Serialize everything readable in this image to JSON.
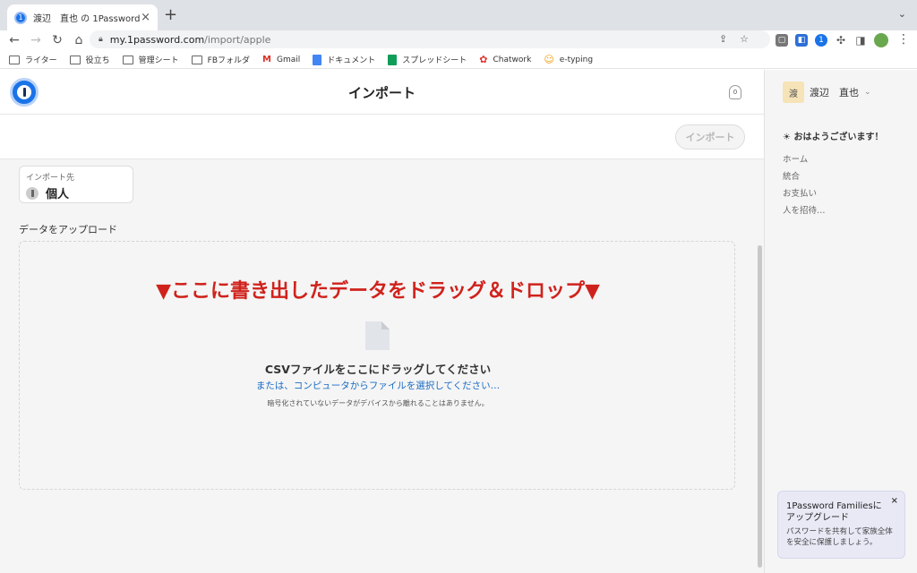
{
  "browser": {
    "tab_title": "渡辺　直也 の 1Password",
    "tab_close": "×",
    "new_tab": "+",
    "url_host": "my.1password.com",
    "url_path": "/import/apple"
  },
  "bookmarks": [
    {
      "label": "ライター",
      "icon": "folder-icon"
    },
    {
      "label": "役立ち",
      "icon": "folder-icon"
    },
    {
      "label": "管理シート",
      "icon": "folder-icon"
    },
    {
      "label": "FBフォルダ",
      "icon": "folder-icon"
    },
    {
      "label": "Gmail",
      "icon": "gmail-icon"
    },
    {
      "label": "ドキュメント",
      "icon": "docs-icon"
    },
    {
      "label": "スプレッドシート",
      "icon": "sheets-icon"
    },
    {
      "label": "Chatwork",
      "icon": "chatwork-icon"
    },
    {
      "label": "e-typing",
      "icon": "etyping-icon"
    }
  ],
  "header": {
    "title": "インポート",
    "notification_count": "0"
  },
  "actions": {
    "import_button": "インポート"
  },
  "destination": {
    "label": "インポート先",
    "vault_name": "個人"
  },
  "upload": {
    "heading": "データをアップロード",
    "annotation": "▼ここに書き出したデータをドラッグ＆ドロップ▼",
    "drop_text": "CSVファイルをここにドラッグしてください",
    "select_link": "または、コンピュータからファイルを選択してください…",
    "privacy_note": "暗号化されていないデータがデバイスから離れることはありません。"
  },
  "sidebar": {
    "user_initial": "渡",
    "user_name": "渡辺　直也",
    "greeting": "☀ おはようございます！",
    "links": [
      "ホーム",
      "統合",
      "お支払い",
      "人を招待…"
    ]
  },
  "promo": {
    "title": "1Password Familiesにアップグレード",
    "body": "パスワードを共有して家族全体を安全に保護しましょう。",
    "close": "×"
  },
  "colors": {
    "accent_blue": "#1a73e8",
    "annotation_red": "#d0221c",
    "link_blue": "#1a6cc5"
  }
}
